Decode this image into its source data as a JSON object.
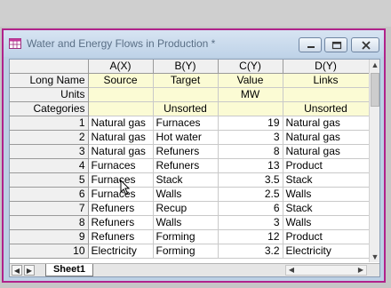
{
  "window": {
    "title": "Water and Energy Flows in Production *",
    "minimize_icon": "minimize-icon",
    "restore_icon": "restore-icon",
    "close_icon": "close-icon"
  },
  "columns": [
    "A(X)",
    "B(Y)",
    "C(Y)",
    "D(Y)"
  ],
  "meta_rows": [
    {
      "label": "Long Name",
      "values": [
        "Source",
        "Target",
        "Value",
        "Links"
      ]
    },
    {
      "label": "Units",
      "values": [
        "",
        "",
        "MW",
        ""
      ]
    },
    {
      "label": "Categories",
      "values": [
        "",
        "Unsorted",
        "",
        "Unsorted"
      ]
    }
  ],
  "rows": [
    {
      "index": "1",
      "values": [
        "Natural gas",
        "Furnaces",
        "19",
        "Natural gas"
      ]
    },
    {
      "index": "2",
      "values": [
        "Natural gas",
        "Hot water",
        "3",
        "Natural gas"
      ]
    },
    {
      "index": "3",
      "values": [
        "Natural gas",
        "Refuners",
        "8",
        "Natural gas"
      ]
    },
    {
      "index": "4",
      "values": [
        "Furnaces",
        "Refuners",
        "13",
        "Product"
      ]
    },
    {
      "index": "5",
      "values": [
        "Furnaces",
        "Stack",
        "3.5",
        "Stack"
      ]
    },
    {
      "index": "6",
      "values": [
        "Furnaces",
        "Walls",
        "2.5",
        "Walls"
      ]
    },
    {
      "index": "7",
      "values": [
        "Refuners",
        "Recup",
        "6",
        "Stack"
      ]
    },
    {
      "index": "8",
      "values": [
        "Refuners",
        "Walls",
        "3",
        "Walls"
      ]
    },
    {
      "index": "9",
      "values": [
        "Refuners",
        "Forming",
        "12",
        "Product"
      ]
    },
    {
      "index": "10",
      "values": [
        "Electricity",
        "Forming",
        "3.2",
        "Electricity"
      ]
    }
  ],
  "sheet_tab": "Sheet1"
}
